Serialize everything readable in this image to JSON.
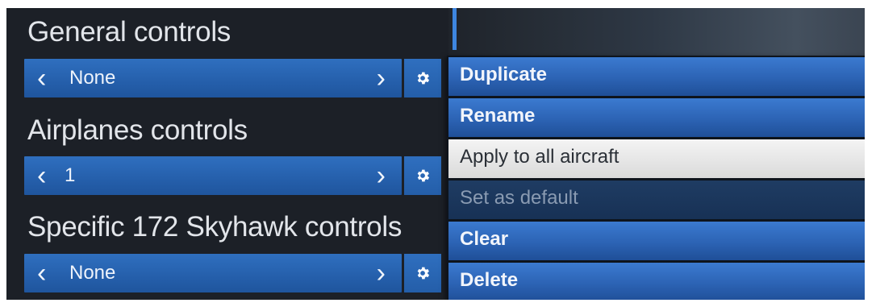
{
  "colors": {
    "selector_blue": "#2a66b6",
    "menu_blue": "#2c63b4",
    "hover_item": "#e6e6e6",
    "disabled_item": "#1b355b",
    "panel_dark": "#1c2027",
    "accent": "#3e86e0"
  },
  "sections": [
    {
      "label": "General controls",
      "selector": {
        "prev_icon": "chevron-left-icon",
        "value": "None",
        "next_icon": "chevron-right-icon"
      },
      "settings_icon": "gear-icon"
    },
    {
      "label": "Airplanes controls",
      "selector": {
        "prev_icon": "chevron-left-icon",
        "value": "1",
        "next_icon": "chevron-right-icon"
      },
      "settings_icon": "gear-icon"
    },
    {
      "label": "Specific 172 Skyhawk controls",
      "selector": {
        "prev_icon": "chevron-left-icon",
        "value": "None",
        "next_icon": "chevron-right-icon"
      },
      "settings_icon": "gear-icon"
    }
  ],
  "context_menu": {
    "items": [
      {
        "label": "Duplicate",
        "state": "normal"
      },
      {
        "label": "Rename",
        "state": "normal"
      },
      {
        "label": "Apply to all aircraft",
        "state": "hovered"
      },
      {
        "label": "Set as default",
        "state": "disabled"
      },
      {
        "label": "Clear",
        "state": "normal"
      },
      {
        "label": "Delete",
        "state": "normal"
      }
    ]
  }
}
